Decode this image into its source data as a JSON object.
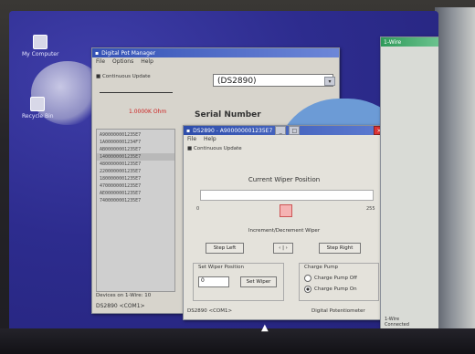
{
  "desktop": {
    "icons": [
      {
        "label": "My Computer"
      },
      {
        "label": "Recycle Bin"
      }
    ]
  },
  "main_window": {
    "title": "Digital Pot Manager",
    "menu": [
      "File",
      "Options",
      "Help"
    ],
    "checkbox_label": "Continuous Update",
    "serial_select_value": "(DS2890)",
    "serial_label": "Serial Number",
    "resistance_label": "1.0000K Ohm",
    "devices": [
      "A900000001235E7",
      "1A00000001234F7",
      "AB00000001235E7",
      "1400000001235E7",
      "4800000001235E7",
      "2200000001235E7",
      "1800000001235E7",
      "4700000001235E7",
      "AE00000001235E7",
      "7400000001235E7"
    ],
    "selected_index": 3,
    "status": "Devices on 1-Wire: 10",
    "footer": "DS2890 <COM1>"
  },
  "dialog": {
    "title": "DS2890 - A900000001235E7",
    "menu": [
      "File",
      "Help"
    ],
    "checkbox_label": "Continuous Update",
    "wiper_title": "Current Wiper Position",
    "scale_min": "0",
    "scale_max": "255",
    "wiper_value": 0.5,
    "inc_dec_title": "Increment/Decrement Wiper",
    "step_left": "Step Left",
    "step_right": "Step Right",
    "set_group_title": "Set Wiper Position",
    "spin_value": "0",
    "set_button": "Set Wiper",
    "pump_group_title": "Charge Pump",
    "radio_off": "Charge Pump Off",
    "radio_on": "Charge Pump On",
    "footer_left": "DS2890 <COM1>",
    "footer_right": "Digital Potentiometer"
  },
  "side_window": {
    "title": "1-Wire",
    "status_1": "1-Wire",
    "status_2": "Connected"
  }
}
